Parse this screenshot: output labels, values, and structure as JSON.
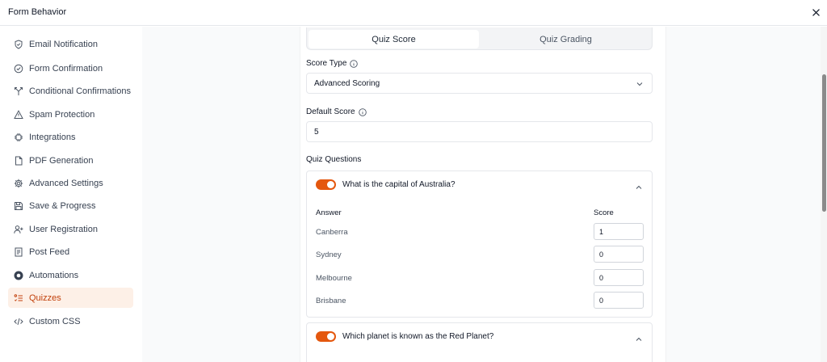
{
  "header": {
    "title": "Form Behavior"
  },
  "sidebar": {
    "items": [
      {
        "label": "Email Notification",
        "icon": "shield-check-icon"
      },
      {
        "label": "Form Confirmation",
        "icon": "check-circle-icon"
      },
      {
        "label": "Conditional Confirmations",
        "icon": "branch-icon"
      },
      {
        "label": "Spam Protection",
        "icon": "warning-icon"
      },
      {
        "label": "Integrations",
        "icon": "chip-icon"
      },
      {
        "label": "PDF Generation",
        "icon": "document-icon"
      },
      {
        "label": "Advanced Settings",
        "icon": "gear-icon"
      },
      {
        "label": "Save & Progress",
        "icon": "save-icon"
      },
      {
        "label": "User Registration",
        "icon": "user-plus-icon"
      },
      {
        "label": "Post Feed",
        "icon": "post-icon"
      },
      {
        "label": "Automations",
        "icon": "automation-icon"
      },
      {
        "label": "Quizzes",
        "icon": "quiz-list-icon",
        "active": true
      },
      {
        "label": "Custom CSS",
        "icon": "code-icon"
      }
    ]
  },
  "tabs": {
    "quiz_score": "Quiz Score",
    "quiz_grading": "Quiz Grading"
  },
  "score_type": {
    "label": "Score Type",
    "value": "Advanced Scoring"
  },
  "default_score": {
    "label": "Default Score",
    "value": "5"
  },
  "quiz_questions": {
    "label": "Quiz Questions",
    "answer_header": "Answer",
    "score_header": "Score",
    "questions": [
      {
        "text": "What is the capital of Australia?",
        "enabled": true,
        "answers": [
          {
            "answer": "Canberra",
            "score": "1"
          },
          {
            "answer": "Sydney",
            "score": "0"
          },
          {
            "answer": "Melbourne",
            "score": "0"
          },
          {
            "answer": "Brisbane",
            "score": "0"
          }
        ]
      },
      {
        "text": "Which planet is known as the Red Planet?",
        "enabled": true
      }
    ]
  },
  "colors": {
    "accent": "#e4570e",
    "active_bg": "#fdf0e7",
    "active_text": "#c2410c"
  }
}
